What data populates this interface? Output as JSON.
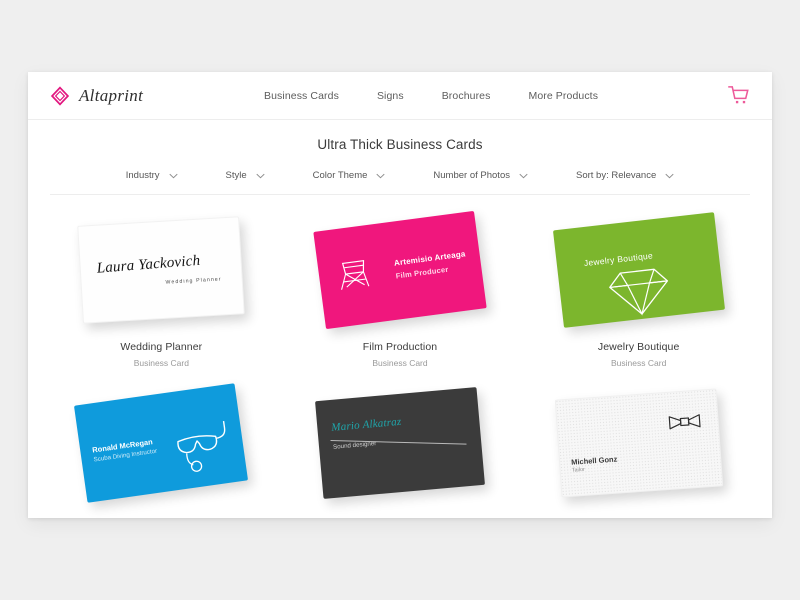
{
  "header": {
    "brand_name": "Altaprint",
    "brand_icon": "diamond-logo-icon",
    "brand_color": "#E2177F",
    "nav": [
      {
        "label": "Business Cards"
      },
      {
        "label": "Signs"
      },
      {
        "label": "Brochures"
      },
      {
        "label": "More Products"
      }
    ],
    "cart_icon": "shopping-cart-icon",
    "cart_color": "#ED5A9A"
  },
  "page": {
    "title": "Ultra Thick Business Cards",
    "background_color": "#EFEFEF",
    "surface_color": "#FFFFFF"
  },
  "filters": [
    {
      "label": "Industry",
      "icon": "chevron-down-icon"
    },
    {
      "label": "Style",
      "icon": "chevron-down-icon"
    },
    {
      "label": "Color Theme",
      "icon": "chevron-down-icon"
    },
    {
      "label": "Number of Photos",
      "icon": "chevron-down-icon"
    },
    {
      "label": "Sort by: Relevance",
      "icon": "chevron-down-icon"
    }
  ],
  "products": [
    {
      "title": "Wedding Planner",
      "subtitle": "Business Card",
      "card_color": "#FEFEFE",
      "design": {
        "name": "Laura Yackovich",
        "role": "Wedding Planner",
        "icon": "none"
      }
    },
    {
      "title": "Film Production",
      "subtitle": "Business Card",
      "card_color": "#F0177D",
      "design": {
        "name": "Artemisio Arteaga",
        "role": "Film Producer",
        "icon": "director-chair-icon"
      }
    },
    {
      "title": "Jewelry Boutique",
      "subtitle": "Business Card",
      "card_color": "#7CB62D",
      "design": {
        "name": "Jewelry Boutique",
        "role": "",
        "icon": "gem-diamond-icon"
      }
    },
    {
      "title": "",
      "subtitle": "",
      "card_color": "#0F9BDC",
      "design": {
        "name": "Ronald McRegan",
        "role": "Scuba Diving Instructor",
        "icon": "diving-mask-snorkel-icon"
      }
    },
    {
      "title": "",
      "subtitle": "",
      "card_color": "#3B3B3B",
      "design": {
        "name": "Mario Alkatraz",
        "role": "Sound designer",
        "icon": "none"
      }
    },
    {
      "title": "",
      "subtitle": "",
      "card_color": "#F7F7F7",
      "design": {
        "name": "Michell Gonz",
        "role": "Tailor",
        "icon": "bow-tie-icon"
      }
    }
  ]
}
